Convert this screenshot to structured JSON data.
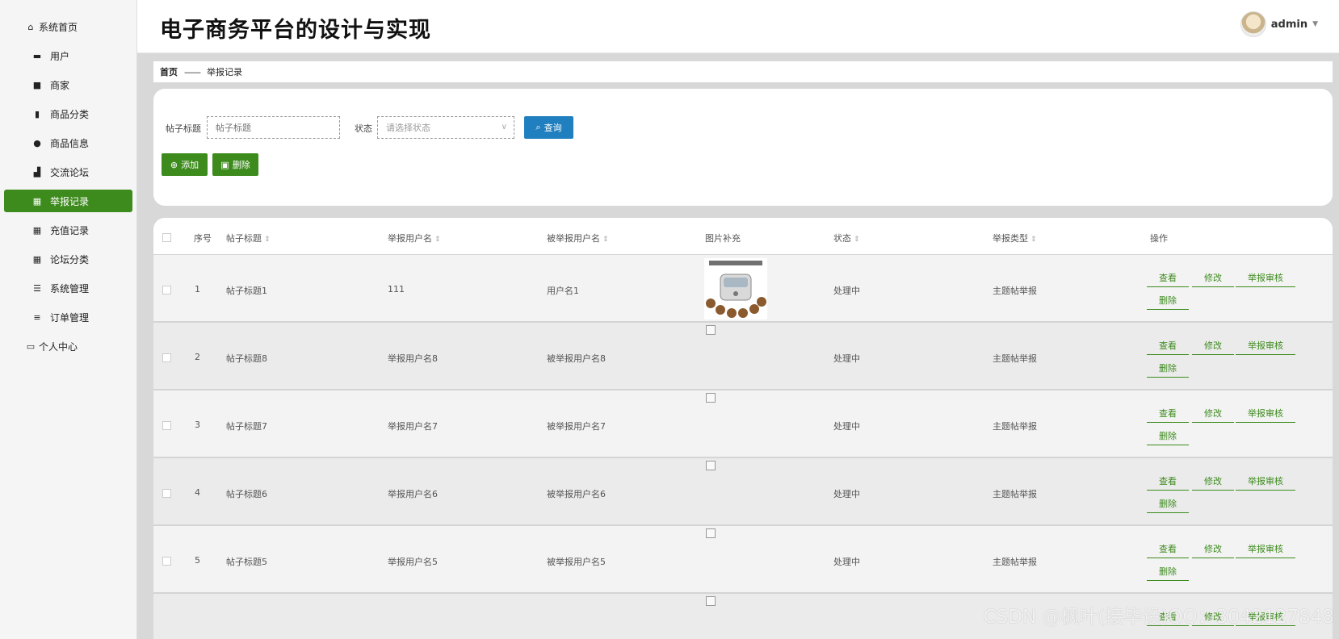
{
  "sidebar": {
    "items": [
      {
        "label": "系统首页",
        "icon": "home-icon"
      },
      {
        "label": "用户",
        "icon": "briefcase-icon"
      },
      {
        "label": "商家",
        "icon": "chat-icon"
      },
      {
        "label": "商品分类",
        "icon": "clipboard-icon"
      },
      {
        "label": "商品信息",
        "icon": "user-icon"
      },
      {
        "label": "交流论坛",
        "icon": "bar-chart-icon"
      },
      {
        "label": "举报记录",
        "icon": "grid-icon"
      },
      {
        "label": "充值记录",
        "icon": "grid-icon"
      },
      {
        "label": "论坛分类",
        "icon": "grid-icon"
      },
      {
        "label": "系统管理",
        "icon": "sliders-icon"
      },
      {
        "label": "订单管理",
        "icon": "list-icon"
      },
      {
        "label": "个人中心",
        "icon": "window-icon"
      }
    ]
  },
  "header": {
    "title": "电子商务平台的设计与实现",
    "username": "admin"
  },
  "breadcrumb": {
    "home": "首页",
    "separator": "——",
    "current": "举报记录"
  },
  "search": {
    "title_label": "帖子标题",
    "title_placeholder": "帖子标题",
    "status_label": "状态",
    "status_placeholder": "请选择状态",
    "query_button": "查询",
    "add_button": "添加",
    "delete_button": "删除"
  },
  "table": {
    "headers": {
      "index": "序号",
      "title": "帖子标题",
      "reporter": "举报用户名",
      "reported": "被举报用户名",
      "image": "图片补充",
      "status": "状态",
      "type": "举报类型",
      "actions": "操作"
    },
    "rows": [
      {
        "index": "1",
        "title": "帖子标题1",
        "reporter": "111",
        "reported": "用户名1",
        "status": "处理中",
        "type": "主题帖举报"
      },
      {
        "index": "2",
        "title": "帖子标题8",
        "reporter": "举报用户名8",
        "reported": "被举报用户名8",
        "status": "处理中",
        "type": "主题帖举报"
      },
      {
        "index": "3",
        "title": "帖子标题7",
        "reporter": "举报用户名7",
        "reported": "被举报用户名7",
        "status": "处理中",
        "type": "主题帖举报"
      },
      {
        "index": "4",
        "title": "帖子标题6",
        "reporter": "举报用户名6",
        "reported": "被举报用户名6",
        "status": "处理中",
        "type": "主题帖举报"
      },
      {
        "index": "5",
        "title": "帖子标题5",
        "reporter": "举报用户名5",
        "reported": "被举报用户名5",
        "status": "处理中",
        "type": "主题帖举报"
      },
      {
        "index": "",
        "title": "",
        "reporter": "",
        "reported": "",
        "status": "",
        "type": ""
      }
    ],
    "actions": {
      "view": "查看",
      "edit": "修改",
      "review": "举报审核",
      "delete": "删除"
    }
  },
  "watermark": "CSDN @枫叶(接毕设)QQ：3042127848",
  "colors": {
    "accent_green": "#3d8b1d",
    "query_blue": "#1f7fbf"
  }
}
